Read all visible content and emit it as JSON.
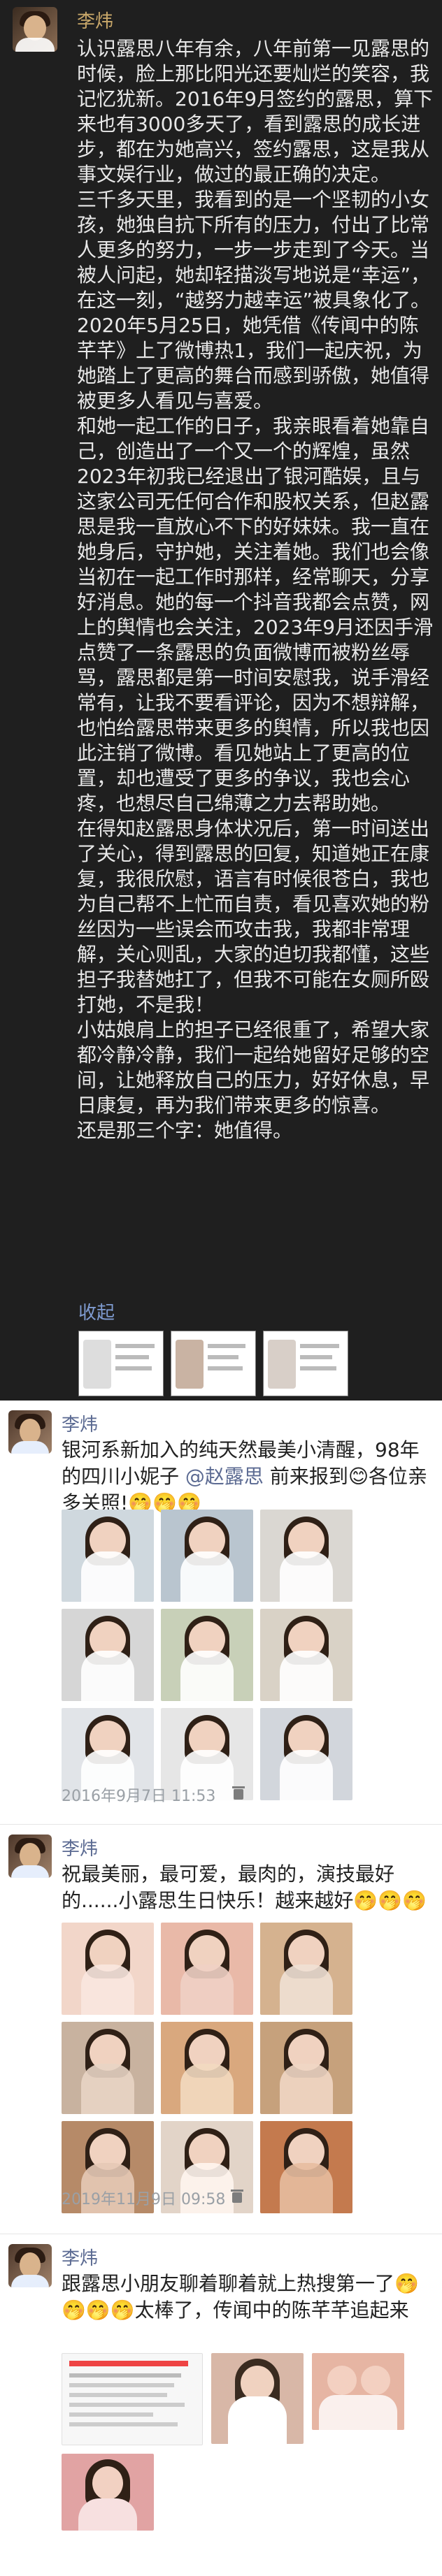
{
  "post1": {
    "name": "李炜",
    "paragraphs": [
      "认识露思八年有余，八年前第一见露思的时候，脸上那比阳光还要灿烂的笑容，我记忆犹新。2016年9月签约的露思，算下来也有3000多天了，看到露思的成长进步，都在为她高兴，签约露思，这是我从事文娱行业，做过的最正确的决定。",
      "三千多天里，我看到的是一个坚韧的小女孩，她独自抗下所有的压力，付出了比常人更多的努力，一步一步走到了今天。当被人问起，她却轻描淡写地说是“幸运”，在这一刻，“越努力越幸运”被具象化了。",
      "2020年5月25日，她凭借《传闻中的陈芊芊》上了微博热1，我们一起庆祝，为她踏上了更高的舞台而感到骄傲，她值得被更多人看见与喜爱。",
      "和她一起工作的日子，我亲眼看着她靠自己，创造出了一个又一个的辉煌，虽然2023年初我已经退出了银河酷娱，且与这家公司无任何合作和股权关系，但赵露思是我一直放心不下的好妹妹。我一直在她身后，守护她，关注着她。我们也会像当初在一起工作时那样，经常聊天，分享好消息。她的每一个抖音我都会点赞，网上的舆情也会关注，2023年9月还因手滑点赞了一条露思的负面微博而被粉丝辱骂，露思都是第一时间安慰我，说手滑经常有，让我不要看评论，因为不想辩解，也怕给露思带来更多的舆情，所以我也因此注销了微博。看见她站上了更高的位置，却也遭受了更多的争议，我也会心疼，也想尽自己绵薄之力去帮助她。",
      "在得知赵露思身体状况后，第一时间送出了关心，得到露思的回复，知道她正在康复，我很欣慰，语言有时候很苍白，我也为自己帮不上忙而自责，看见喜欢她的粉丝因为一些误会而攻击我，我都非常理解，关心则乱，大家的迫切我都懂，这些担子我替她扛了，但我不可能在女厕所殴打她，不是我！",
      "小姑娘肩上的担子已经很重了，希望大家都冷静冷静，我们一起给她留好足够的空间，让她释放自己的压力，好好休息，早日康复，再为我们带来更多的惊喜。",
      "还是那三个字：她值得。"
    ],
    "collapse_label": "收起"
  },
  "post2": {
    "name": "李炜",
    "text_before": "银河系新加入的纯天然最美小清醒，98年的四川小妮子",
    "mention": "@赵露思",
    "text_after": "前来报到😊各位亲多关照!🤭🤭🤭",
    "time": "2016年9月7日 11:53"
  },
  "post3": {
    "name": "李炜",
    "text": "祝最美丽，最可爱，最肉的，演技最好的......小露思生日快乐！越来越好🤭🤭🤭",
    "time": "2019年11月9日 09:58"
  },
  "post4": {
    "name": "李炜",
    "text": "跟露思小朋友聊着聊着就上热搜第一了🤭🤭🤭🤭太棒了，传闻中的陈芊芊追起来"
  },
  "icons": {
    "trash": "trash-icon"
  },
  "colors": {
    "dark_bg": "#1f1f1f",
    "name_gold": "#c9a86a",
    "link_blue": "#5b6a92"
  }
}
